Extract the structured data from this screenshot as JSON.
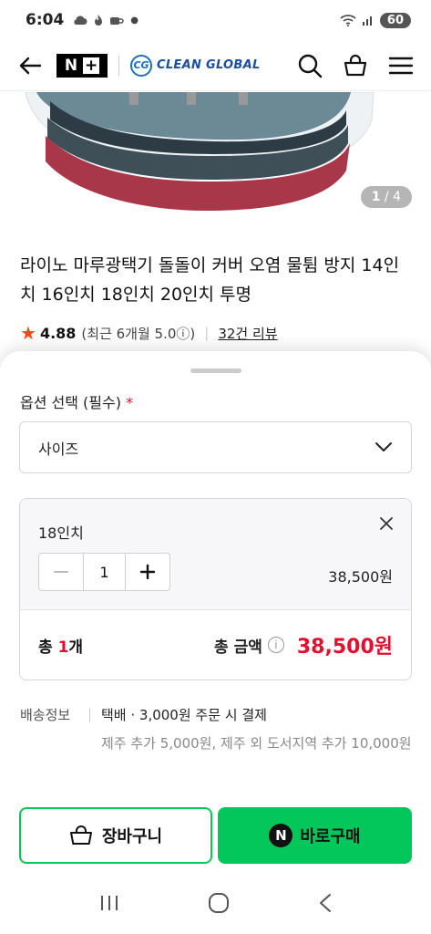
{
  "status_bar": {
    "time": "6:04",
    "battery": "60",
    "left_icons": [
      "cloud-icon",
      "fire-icon",
      "coffee-icon",
      "dot-icon"
    ],
    "right_icons": [
      "wifi-icon",
      "signal-icon",
      "battery-icon"
    ]
  },
  "header": {
    "nplus_label": "N",
    "nplus_plus": "+",
    "brand_mark": "CG",
    "brand_name": "CLEAN GLOBAL",
    "icons": [
      "back-arrow-icon",
      "search-icon",
      "basket-icon",
      "menu-icon"
    ]
  },
  "gallery": {
    "current": "1",
    "separator": "/",
    "total": "4"
  },
  "product": {
    "title": "라이노 마루광택기 돌돌이 커버 오염 물튐 방지 14인치 16인치 18인치 20인치 투명",
    "rating": "4.88",
    "rating_detail": "(최근 6개월 5.0ⓘ)",
    "review_count": "32건 리뷰"
  },
  "options": {
    "label": "옵션 선택 (필수)",
    "required_mark": "*",
    "select_value": "사이즈"
  },
  "selected_item": {
    "name": "18인치",
    "quantity": "1",
    "price": "38,500원"
  },
  "totals": {
    "count_prefix": "총 ",
    "count_num": "1",
    "count_suffix": "개",
    "label": "총 금액",
    "info": "i",
    "price": "38,500원"
  },
  "delivery": {
    "label": "배송정보",
    "main": "택배 · 3,000원 주문 시 결제",
    "extra": "제주 추가 5,000원, 제주 외 도서지역 추가 10,000원"
  },
  "actions": {
    "cart_label": "장바구니",
    "buy_badge": "N",
    "buy_label": "바로구매"
  },
  "colors": {
    "accent_green": "#03c75a",
    "price_red": "#e0102e",
    "star_orange": "#f04a1a",
    "brand_blue": "#1b6fbf"
  }
}
